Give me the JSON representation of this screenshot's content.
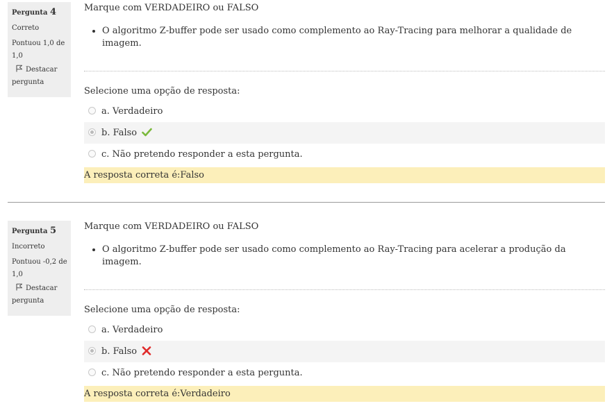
{
  "questions": [
    {
      "label": "Pergunta",
      "number": "4",
      "state": "Correto",
      "grade": "Pontuou 1,0 de 1,0",
      "flag_label": "Destacar pergunta",
      "instruction": "Marque com VERDADEIRO ou FALSO",
      "statement": "O algoritmo Z-buffer pode ser usado como complemento ao Ray-Tracing para melhorar a qualidade de imagem.",
      "prompt": "Selecione uma opção de resposta:",
      "options": [
        {
          "label": "a. Verdadeiro",
          "selected": false
        },
        {
          "label": "b. Falso",
          "selected": true,
          "mark": "correct-check-icon"
        },
        {
          "label": "c. Não pretendo responder a esta pergunta.",
          "selected": false
        }
      ],
      "right_answer": "A resposta correta é:Falso"
    },
    {
      "label": "Pergunta",
      "number": "5",
      "state": "Incorreto",
      "grade": "Pontuou -0,2 de 1,0",
      "flag_label": "Destacar pergunta",
      "instruction": "Marque com VERDADEIRO ou FALSO",
      "statement": "O algoritmo Z-buffer pode ser usado como complemento ao Ray-Tracing para acelerar a produção da imagem.",
      "prompt": "Selecione uma opção de resposta:",
      "options": [
        {
          "label": "a. Verdadeiro",
          "selected": false
        },
        {
          "label": "b. Falso",
          "selected": true,
          "mark": "incorrect-cross-icon"
        },
        {
          "label": "c. Não pretendo responder a esta pergunta.",
          "selected": false
        }
      ],
      "right_answer": "A resposta correta é:Verdadeiro"
    }
  ],
  "colors": {
    "info_bg": "#eeeeee",
    "selected_bg": "#f4f4f4",
    "feedback_bg": "#fcefba",
    "correct": "#7ab93b",
    "incorrect": "#e02a2a"
  }
}
